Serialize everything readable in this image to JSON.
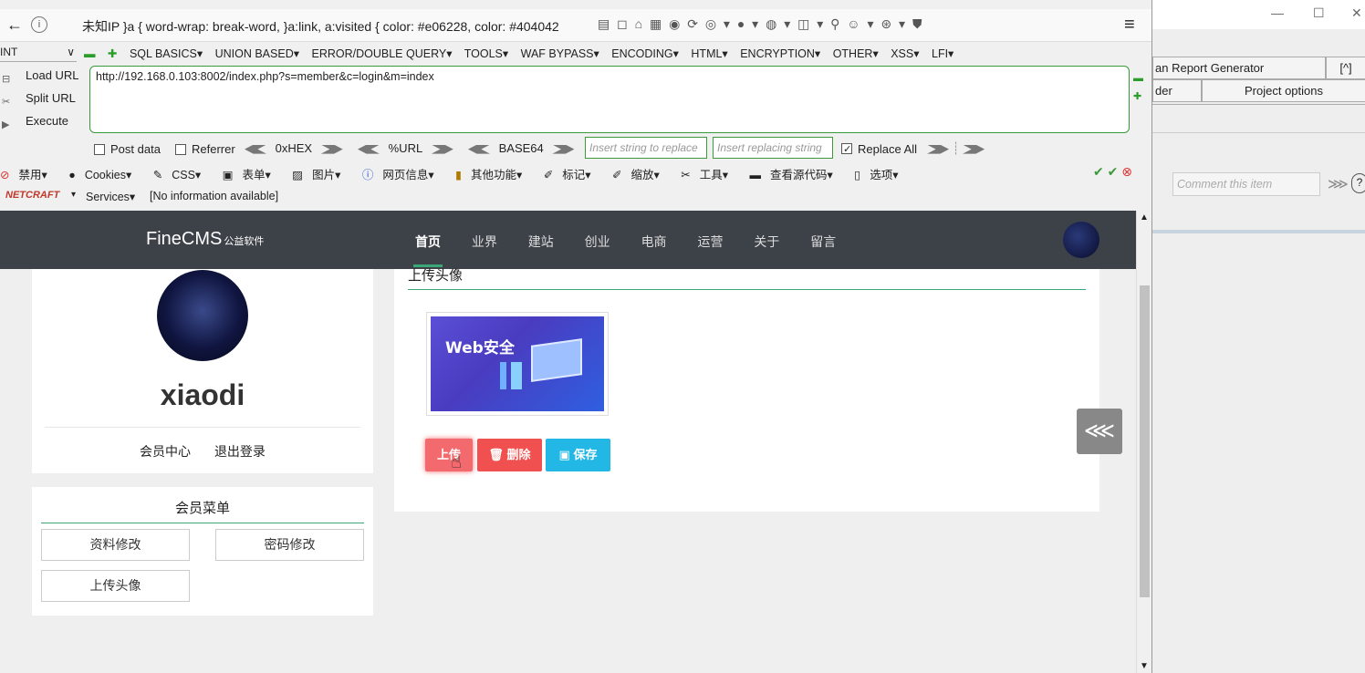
{
  "browser": {
    "address_text": "未知IP   }a { word-wrap: break-word, }a:link, a:visited { color: #e06228, color: #404042",
    "back_icon": "arrow-left-icon",
    "info_icon": "info-icon",
    "menu_icon": "hamburger-icon"
  },
  "hackbar": {
    "selector": "INT",
    "menu_items": [
      "SQL BASICS▾",
      "UNION BASED▾",
      "ERROR/DOUBLE QUERY▾",
      "TOOLS▾",
      "WAF BYPASS▾",
      "ENCODING▾",
      "HTML▾",
      "ENCRYPTION▾",
      "OTHER▾",
      "XSS▾",
      "LFI▾"
    ],
    "load_url": "Load URL",
    "split_url": "Split URL",
    "execute": "Execute",
    "url": "http://192.168.0.103:8002/index.php?s=member&c=login&m=index",
    "post_data": "Post data",
    "referrer": "Referrer",
    "hex": "0xHEX",
    "urlenc": "%URL",
    "base64": "BASE64",
    "replace_placeholder": "Insert string to replace",
    "replacing_placeholder": "Insert replacing string",
    "replace_all": "Replace All"
  },
  "webdev": {
    "items": [
      "禁用▾",
      "Cookies▾",
      "CSS▾",
      "表单▾",
      "图片▾",
      "网页信息▾",
      "其他功能▾",
      "标记▾",
      "缩放▾",
      "工具▾",
      "查看源代码▾",
      "选项▾"
    ]
  },
  "netcraft": {
    "logo": "NETCRAFT",
    "services": "Services▾",
    "info": "[No information available]"
  },
  "site": {
    "brand": "FineCMS",
    "brand_sub": "公益软件",
    "nav": [
      "首页",
      "业界",
      "建站",
      "创业",
      "电商",
      "运营",
      "关于",
      "留言"
    ],
    "username": "xiaodi",
    "member_center": "会员中心",
    "logout": "退出登录",
    "menu_title": "会员菜单",
    "menu_profile": "资料修改",
    "menu_password": "密码修改",
    "menu_avatar": "上传头像",
    "upload_title": "上传头像",
    "thumb_text": "Web安全",
    "btn_upload": "上传",
    "btn_delete": "删除",
    "btn_save": "保存"
  },
  "burp": {
    "tab_report": "an Report Generator",
    "tab_caret": "[^]",
    "tab_der": "der",
    "tab_project": "Project options",
    "comment_placeholder": "Comment this item"
  }
}
